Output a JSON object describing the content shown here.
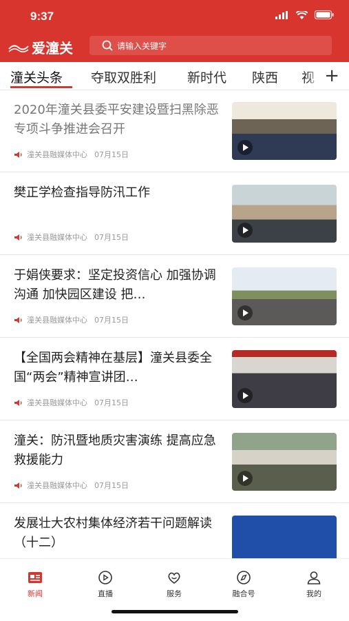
{
  "status": {
    "time": "9:37"
  },
  "header": {
    "logo_text": "爱潼关",
    "search_placeholder": "请输入关键字"
  },
  "tabs": [
    {
      "label": "潼关头条",
      "active": true
    },
    {
      "label": "夺取双胜利"
    },
    {
      "label": "新时代"
    },
    {
      "label": "陕西"
    },
    {
      "label": "视"
    }
  ],
  "news": [
    {
      "title": "2020年潼关县委平安建设暨扫黑除恶专项斗争推进会召开",
      "source": "潼关县融媒体中心",
      "date": "07月15日",
      "visited": true
    },
    {
      "title": "樊正学检查指导防汛工作",
      "source": "潼关县融媒体中心",
      "date": "07月15日"
    },
    {
      "title": "于娟侠要求：坚定投资信心 加强协调沟通  加快园区建设 把…",
      "source": "潼关县融媒体中心",
      "date": "07月15日"
    },
    {
      "title": "【全国两会精神在基层】潼关县委全国“两会”精神宣讲团…",
      "source": "潼关县融媒体中心",
      "date": "07月15日"
    },
    {
      "title": "潼关：防汛暨地质灾害演练 提高应急救援能力",
      "source": "潼关县融媒体中心",
      "date": "07月15日"
    },
    {
      "title": "发展壮大农村集体经济若干问题解读（十二）",
      "source": "",
      "date": ""
    }
  ],
  "bottom_nav": [
    {
      "label": "新闻",
      "icon": "news-icon",
      "active": true
    },
    {
      "label": "直播",
      "icon": "live-icon"
    },
    {
      "label": "服务",
      "icon": "service-icon"
    },
    {
      "label": "融合号",
      "icon": "compass-icon"
    },
    {
      "label": "我的",
      "icon": "profile-icon"
    }
  ],
  "colors": {
    "brand": "#d9352f"
  }
}
